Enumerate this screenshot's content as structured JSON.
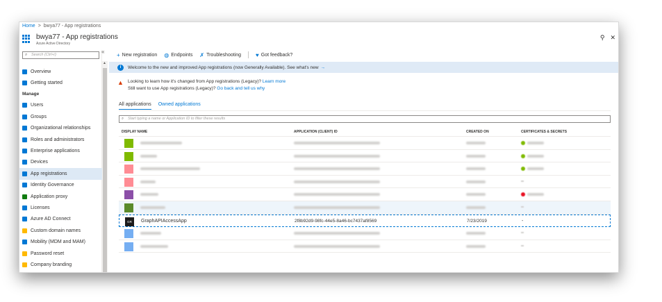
{
  "breadcrumb": {
    "home": "Home",
    "separator": ">",
    "current": "bwya77 - App registrations"
  },
  "header": {
    "title": "bwya77 - App registrations",
    "subtitle": "Azure Active Directory",
    "pin_icon": "pin-icon",
    "close_icon": "close-icon"
  },
  "sidebar": {
    "search_placeholder": "Search (Ctrl+/)",
    "collapse_glyph": "«",
    "top_items": [
      {
        "label": "Overview",
        "icon": "info-icon",
        "color": "#0078d4"
      },
      {
        "label": "Getting started",
        "icon": "rocket-icon",
        "color": "#0078d4"
      }
    ],
    "section_manage": "Manage",
    "items": [
      {
        "label": "Users",
        "icon": "user-icon",
        "color": "#0078d4",
        "active": false
      },
      {
        "label": "Groups",
        "icon": "group-icon",
        "color": "#0078d4",
        "active": false
      },
      {
        "label": "Organizational relationships",
        "icon": "org-icon",
        "color": "#0078d4",
        "active": false
      },
      {
        "label": "Roles and administrators",
        "icon": "roles-icon",
        "color": "#0078d4",
        "active": false
      },
      {
        "label": "Enterprise applications",
        "icon": "grid-icon",
        "color": "#0078d4",
        "active": false
      },
      {
        "label": "Devices",
        "icon": "device-icon",
        "color": "#0078d4",
        "active": false
      },
      {
        "label": "App registrations",
        "icon": "app-reg-icon",
        "color": "#0078d4",
        "active": true
      },
      {
        "label": "Identity Governance",
        "icon": "governance-icon",
        "color": "#0078d4",
        "active": false
      },
      {
        "label": "Application proxy",
        "icon": "proxy-icon",
        "color": "#107c10",
        "active": false
      },
      {
        "label": "Licenses",
        "icon": "license-icon",
        "color": "#0078d4",
        "active": false
      },
      {
        "label": "Azure AD Connect",
        "icon": "connect-icon",
        "color": "#0078d4",
        "active": false
      },
      {
        "label": "Custom domain names",
        "icon": "domain-icon",
        "color": "#ffb900",
        "active": false
      },
      {
        "label": "Mobility (MDM and MAM)",
        "icon": "mobility-icon",
        "color": "#0078d4",
        "active": false
      },
      {
        "label": "Password reset",
        "icon": "key-icon",
        "color": "#ffb900",
        "active": false
      },
      {
        "label": "Company branding",
        "icon": "branding-icon",
        "color": "#ffb900",
        "active": false
      }
    ]
  },
  "toolbar": {
    "new_registration": "New registration",
    "endpoints": "Endpoints",
    "troubleshooting": "Troubleshooting",
    "feedback": "Got feedback?"
  },
  "banner": {
    "text": "Welcome to the new and improved App registrations (now Generally Available). See what's new",
    "arrow": "→"
  },
  "legacy": {
    "line1": "Looking to learn how it's changed from App registrations (Legacy)?",
    "line1_link": "Learn more",
    "line2": "Still want to use App registrations (Legacy)?",
    "line2_link": "Go back and tell us why"
  },
  "tabs": {
    "all": "All applications",
    "owned": "Owned applications"
  },
  "filter_placeholder": "Start typing a name or Application ID to filter these results",
  "table": {
    "headers": {
      "name": "Display name",
      "appid": "Application (client) ID",
      "created": "Created on",
      "certs": "Certificates & secrets"
    },
    "rows": [
      {
        "blurred": true,
        "avatar_color": "#7fba00",
        "name_w": 60,
        "cert": "#7fba00",
        "alt": false
      },
      {
        "blurred": true,
        "avatar_color": "#7fba00",
        "name_w": 24,
        "cert": "#7fba00",
        "alt": false
      },
      {
        "blurred": true,
        "avatar_color": "#ff8c94",
        "name_w": 86,
        "cert": "#7fba00",
        "alt": false
      },
      {
        "blurred": true,
        "avatar_color": "#ff8c94",
        "name_w": 22,
        "cert": "",
        "alt": false
      },
      {
        "blurred": true,
        "avatar_color": "#8c4fa8",
        "name_w": 26,
        "cert": "#e81123",
        "alt": false
      },
      {
        "blurred": true,
        "avatar_color": "#5a8a2a",
        "name_w": 36,
        "cert": "",
        "alt": true
      },
      {
        "blurred": false,
        "avatar_color": "#1b1b1b",
        "avatar_text": "GR",
        "name": "GraphAPIAccessApp",
        "appid": "2f8b92d9-98fc-44e5-8a46-bc7437af8569",
        "created": "7/23/2019",
        "certs": "-",
        "alt": false
      },
      {
        "blurred": true,
        "avatar_color": "#75aef2",
        "name_w": 30,
        "cert": "",
        "alt": false
      },
      {
        "blurred": true,
        "avatar_color": "#75aef2",
        "name_w": 40,
        "cert": "",
        "alt": false
      }
    ]
  }
}
